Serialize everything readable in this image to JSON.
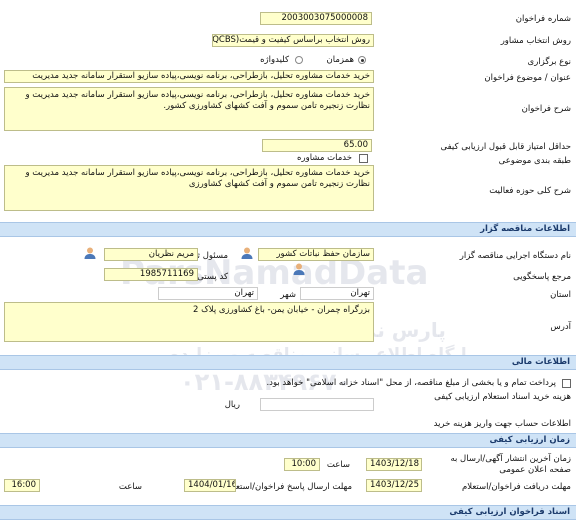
{
  "details": {
    "number_label": "شماره فراخوان",
    "number_value": "2003003075000008",
    "method_label": "روش انتخاب مشاور",
    "method_value": "روش انتخاب براساس کیفیت و قیمت(QCBS)",
    "type_label": "نوع برگزاری",
    "type_opt1": "همزمان",
    "type_opt2": "کلیدواژه",
    "title_label": "عنوان / موضوع فراخوان",
    "title_value": "خرید خدمات مشاوره تحلیل، بازطراحی، برنامه نویسی،پیاده سازیو استقرار سامانه جدید مدیریت",
    "desc_label": "شرح فراخوان",
    "desc_value": "خرید خدمات مشاوره تحلیل، بازطراحی، برنامه نویسی،پیاده سازیو استقرار سامانه جدید مدیریت و نظارت زنجیره تامن سموم و آفت کشهای کشاورزی کشور.",
    "min_score_label": "حداقل امتیاز قابل قبول ارزیابی کیفی",
    "min_score_value": "65.00",
    "category_label": "طبقه بندی موضوعی",
    "category_value": "خدمات مشاوره",
    "activity_label": "شرح کلی حوزه فعالیت",
    "activity_value": "خرید خدمات مشاوره تحلیل، بازطراحی، برنامه نویسی،پیاده سازیو استقرار سامانه جدید مدیریت و نظارت زنجیره تامن سموم و آفت کشهای کشاورزی"
  },
  "organizer": {
    "section_title": "اطلاعات مناقصه گزار",
    "org_label": "نام دستگاه اجرایی مناقصه گزار",
    "org_value": "سازمان حفظ نباتات کشور",
    "officer_label": "مسئول ثبت فراخوان",
    "officer_value": "مریم نظریان",
    "ref_label": "مرجع پاسخگویی",
    "postal_label": "کد پستی",
    "postal_value": "1985711169",
    "province_label": "استان",
    "province_value": "تهران",
    "city_label": "شهر",
    "city_value": "تهران",
    "address_label": "آدرس",
    "address_value": "بزرگراه چمران - خیابان یمن- باغ کشاورزی پلاک 2"
  },
  "financial": {
    "section_title": "اطلاعات مالی",
    "payment_text": "پرداخت تمام و یا بخشی از مبلغ مناقصه، از محل \"اسناد خزانه اسلامی\" خواهد بود.",
    "fee_label": "هزینه خرید اسناد استعلام ارزیابی کیفی",
    "fee_unit": "ریال",
    "account_label": "اطلاعات حساب جهت واریز هزینه خرید"
  },
  "schedule": {
    "section_title": "زمان ارزیابی کیفی",
    "publish_label": "زمان آخرین انتشار آگهی/ارسال به صفحه اعلان عمومی",
    "publish_date": "1403/12/18",
    "time_label": "ساعت",
    "publish_time": "10:00",
    "send_deadline_label": "مهلت دریافت فراخوان/استعلام",
    "send_deadline_date": "1403/12/25",
    "reply_deadline_label": "مهلت ارسال پاسخ فراخوان/استعلام",
    "reply_deadline_date": "1404/01/16",
    "reply_deadline_time": "16:00"
  },
  "footer": {
    "section_title": "اسناد فراخوان ارزیابی کیفی"
  },
  "watermark": {
    "brand": "ParsNamadData",
    "line1": "پارس نماد داده",
    "line2": "پایگاه اطلاع رسانی مناقصه و مزایده",
    "phone": "۰۲۱-۸۸۳۴۹۶۷۰"
  },
  "colors": {
    "field_bg": "#ffffcc",
    "section_bar": "#cfe3f6",
    "section_text": "#1b3a6b"
  }
}
